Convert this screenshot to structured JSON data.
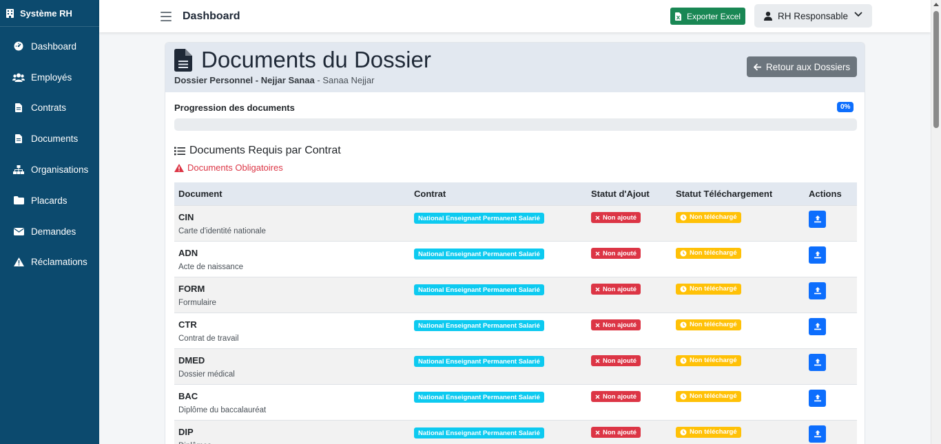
{
  "sidebar": {
    "brand": "Système RH",
    "items": [
      {
        "label": "Dashboard",
        "icon": "dashboard-gauge-icon"
      },
      {
        "label": "Employés",
        "icon": "users-icon"
      },
      {
        "label": "Contrats",
        "icon": "file-icon"
      },
      {
        "label": "Documents",
        "icon": "file-icon"
      },
      {
        "label": "Organisations",
        "icon": "sitemap-icon"
      },
      {
        "label": "Placards",
        "icon": "folder-icon"
      },
      {
        "label": "Demandes",
        "icon": "envelope-icon"
      },
      {
        "label": "Réclamations",
        "icon": "warning-icon"
      }
    ]
  },
  "header": {
    "title": "Dashboard",
    "export_label": "Exporter Excel",
    "user_label": "RH Responsable"
  },
  "page": {
    "title": "Documents du Dossier",
    "subtitle_bold": "Dossier Personnel - Nejjar Sanaa",
    "subtitle_rest": " - Sanaa Nejjar",
    "back_label": "Retour aux Dossiers",
    "progress_label": "Progression des documents",
    "progress_badge": "0%",
    "progress_value": 0,
    "section_title": "Documents Requis par Contrat",
    "required_note": "Documents Obligatoires"
  },
  "table": {
    "headers": [
      "Document",
      "Contrat",
      "Statut d'Ajout",
      "Statut Téléchargement",
      "Actions"
    ],
    "rows": [
      {
        "code": "CIN",
        "desc": "Carte d'identité nationale",
        "contract": "National Enseignant Permanent Salarié",
        "add_status": "Non ajouté",
        "dl_status": "Non téléchargé"
      },
      {
        "code": "ADN",
        "desc": "Acte de naissance",
        "contract": "National Enseignant Permanent Salarié",
        "add_status": "Non ajouté",
        "dl_status": "Non téléchargé"
      },
      {
        "code": "FORM",
        "desc": "Formulaire",
        "contract": "National Enseignant Permanent Salarié",
        "add_status": "Non ajouté",
        "dl_status": "Non téléchargé"
      },
      {
        "code": "CTR",
        "desc": "Contrat de travail",
        "contract": "National Enseignant Permanent Salarié",
        "add_status": "Non ajouté",
        "dl_status": "Non téléchargé"
      },
      {
        "code": "DMED",
        "desc": "Dossier médical",
        "contract": "National Enseignant Permanent Salarié",
        "add_status": "Non ajouté",
        "dl_status": "Non téléchargé"
      },
      {
        "code": "BAC",
        "desc": "Diplôme du baccalauréat",
        "contract": "National Enseignant Permanent Salarié",
        "add_status": "Non ajouté",
        "dl_status": "Non téléchargé"
      },
      {
        "code": "DIP",
        "desc": "Diplômes",
        "contract": "National Enseignant Permanent Salarié",
        "add_status": "Non ajouté",
        "dl_status": "Non téléchargé"
      }
    ]
  },
  "colors": {
    "sidebar": "#0c4a6e",
    "primary": "#0d6efd",
    "success": "#198754",
    "danger": "#dc3545",
    "warning": "#ffc107",
    "info": "#0dcaf0"
  }
}
